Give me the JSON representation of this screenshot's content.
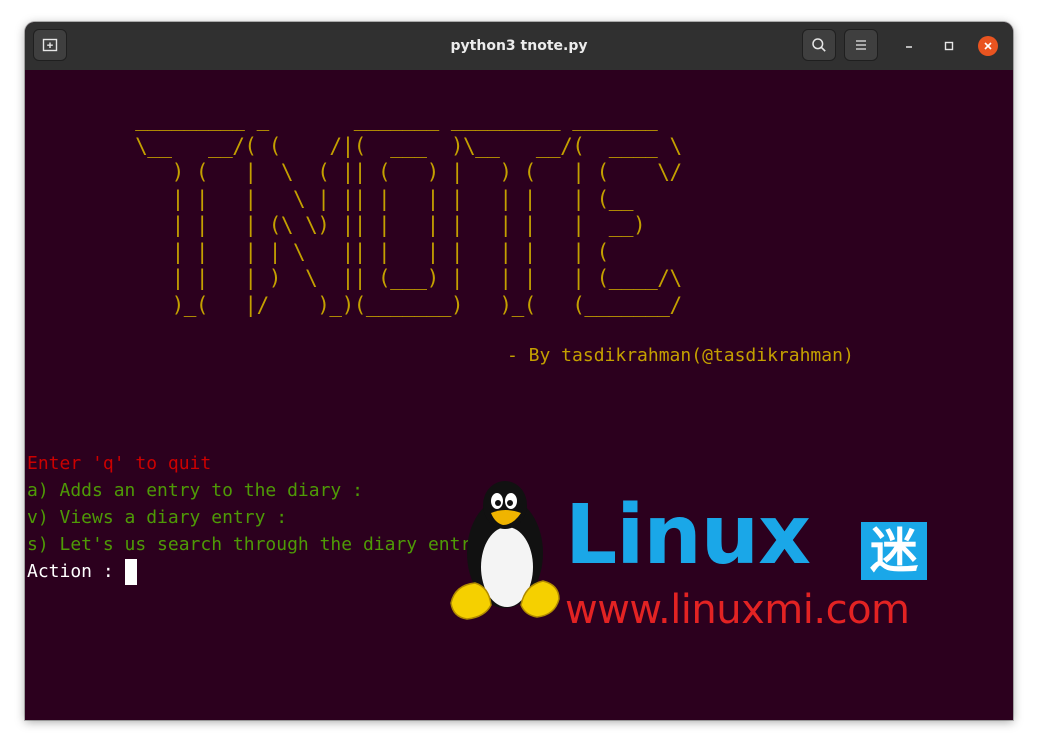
{
  "window": {
    "title": "python3 tnote.py"
  },
  "icons": {
    "new_tab": "new-tab-icon",
    "search": "search-icon",
    "menu": "hamburger-menu-icon",
    "minimize": "minimize-icon",
    "maximize": "maximize-icon",
    "close": "close-icon"
  },
  "colors": {
    "terminal_bg": "#2c001e",
    "titlebar_bg": "#303030",
    "ascii_yellow": "#c4a000",
    "prompt_red": "#cc0000",
    "option_green": "#4e9a06",
    "close_orange": "#e95420"
  },
  "terminal": {
    "banner": " _________ _       _______ _________ _______ \n \\__   __/( (    /|(  ___  )\\__   __/(  ____ \\\n    ) (   |  \\  ( || (   ) |   ) (   | (    \\/\n    | |   |   \\ | || |   | |   | |   | (__    \n    | |   | (\\ \\) || |   | |   | |   |  __)   \n    | |   | | \\   || |   | |   | |   | (      \n    | |   | )  \\  || (___) |   | |   | (____/\\\n    )_(   |/    )_)(_______)   )_(   (_______/",
    "byline": "- By tasdikrahman(@tasdikrahman)",
    "quit_hint": "Enter 'q' to quit",
    "options": [
      "a) Adds an entry to the diary :",
      "v) Views a diary entry :",
      "s) Let's us search through the diary entries"
    ],
    "prompt": "Action : "
  },
  "watermark": {
    "brand": "Linux",
    "badge": "迷",
    "url": "www.linuxmi.com"
  }
}
